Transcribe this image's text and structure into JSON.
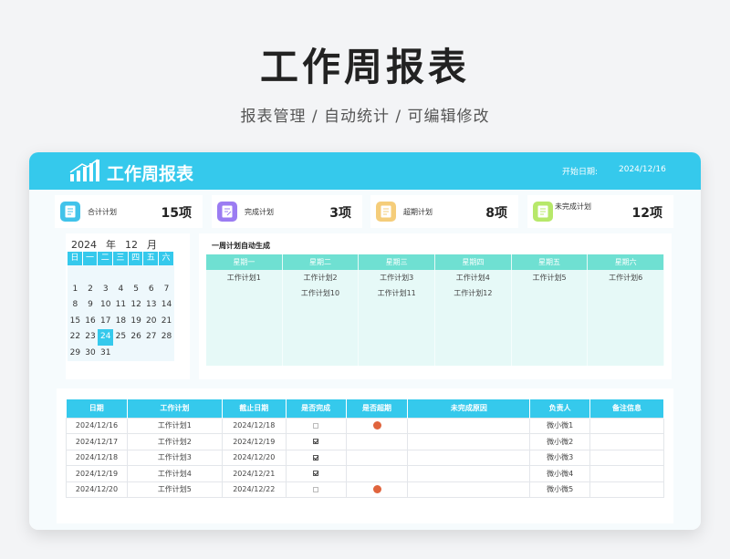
{
  "hero": {
    "title": "工作周报表",
    "subtitle": "报表管理 / 自动统计 / 可编辑修改"
  },
  "banner": {
    "title": "工作周报表",
    "start_label": "开始日期:",
    "start_value": "2024/12/16",
    "accent": "#35c9ec"
  },
  "stats": [
    {
      "label": "合计计划",
      "value": "15项",
      "icon": "document-icon",
      "color": "#41c3ea"
    },
    {
      "label": "完成计划",
      "value": "3项",
      "icon": "document-edit-icon",
      "color": "#9b7cf2"
    },
    {
      "label": "超期计划",
      "value": "8项",
      "icon": "document-icon",
      "color": "#f5cd7a"
    },
    {
      "label": "未完成计划",
      "value": "12项",
      "icon": "document-icon",
      "color": "#b7e86a"
    }
  ],
  "calendar": {
    "year": "2024",
    "year_unit": "年",
    "month": "12",
    "month_unit": "月",
    "weekdays": [
      "日",
      "一",
      "二",
      "三",
      "四",
      "五",
      "六"
    ],
    "weeks": [
      [
        "",
        "",
        "",
        "",
        "",
        "",
        ""
      ],
      [
        "1",
        "2",
        "3",
        "4",
        "5",
        "6",
        "7"
      ],
      [
        "8",
        "9",
        "10",
        "11",
        "12",
        "13",
        "14"
      ],
      [
        "15",
        "16",
        "17",
        "18",
        "19",
        "20",
        "21"
      ],
      [
        "22",
        "23",
        "24",
        "25",
        "26",
        "27",
        "28"
      ],
      [
        "29",
        "30",
        "31",
        "",
        "",
        "",
        ""
      ]
    ],
    "selected": "24"
  },
  "weekly_plan": {
    "title": "一周计划自动生成",
    "days": [
      {
        "name": "星期一",
        "items": [
          "工作计划1"
        ]
      },
      {
        "name": "星期二",
        "items": [
          "工作计划2",
          "工作计划10"
        ]
      },
      {
        "name": "星期三",
        "items": [
          "工作计划3",
          "工作计划11"
        ]
      },
      {
        "name": "星期四",
        "items": [
          "工作计划4",
          "工作计划12"
        ]
      },
      {
        "name": "星期五",
        "items": [
          "工作计划5"
        ]
      },
      {
        "name": "星期六",
        "items": [
          "工作计划6"
        ]
      }
    ]
  },
  "table": {
    "headers": [
      "日期",
      "工作计划",
      "截止日期",
      "是否完成",
      "是否超期",
      "未完成原因",
      "负责人",
      "备注信息"
    ],
    "rows": [
      {
        "date": "2024/12/16",
        "plan": "工作计划1",
        "deadline": "2024/12/18",
        "done": false,
        "overdue": true,
        "reason": "",
        "owner": "微小微1",
        "note": ""
      },
      {
        "date": "2024/12/17",
        "plan": "工作计划2",
        "deadline": "2024/12/19",
        "done": true,
        "overdue": false,
        "reason": "",
        "owner": "微小微2",
        "note": ""
      },
      {
        "date": "2024/12/18",
        "plan": "工作计划3",
        "deadline": "2024/12/20",
        "done": true,
        "overdue": false,
        "reason": "",
        "owner": "微小微3",
        "note": ""
      },
      {
        "date": "2024/12/19",
        "plan": "工作计划4",
        "deadline": "2024/12/21",
        "done": true,
        "overdue": false,
        "reason": "",
        "owner": "微小微4",
        "note": ""
      },
      {
        "date": "2024/12/20",
        "plan": "工作计划5",
        "deadline": "2024/12/22",
        "done": false,
        "overdue": true,
        "reason": "",
        "owner": "微小微5",
        "note": ""
      }
    ],
    "overdue_color": "#e0643d"
  }
}
